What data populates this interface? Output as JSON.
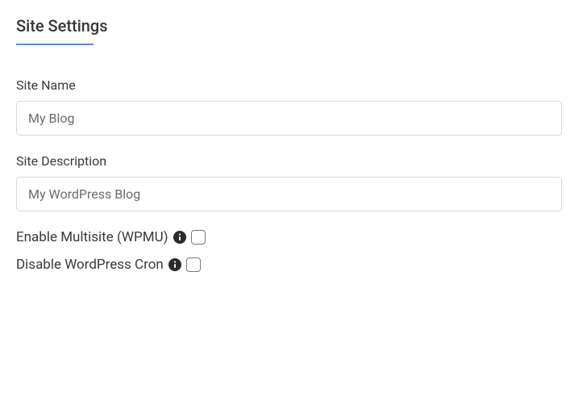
{
  "heading": "Site Settings",
  "fields": {
    "siteName": {
      "label": "Site Name",
      "value": "My Blog"
    },
    "siteDescription": {
      "label": "Site Description",
      "value": "My WordPress Blog"
    }
  },
  "toggles": {
    "multisite": {
      "label": "Enable Multisite (WPMU)",
      "checked": false
    },
    "disableCron": {
      "label": "Disable WordPress Cron",
      "checked": false
    }
  }
}
